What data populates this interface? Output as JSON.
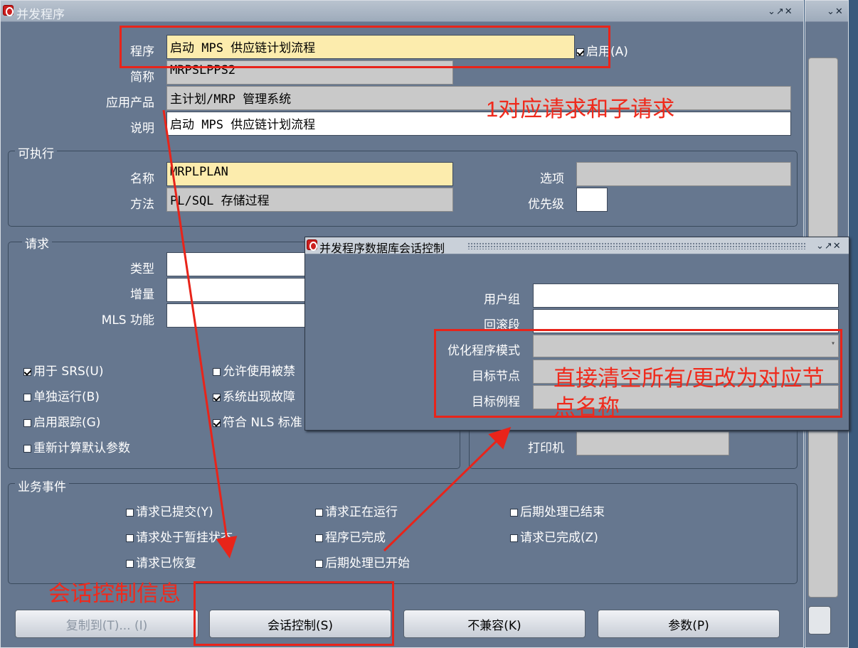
{
  "main_window": {
    "title": "并发程序",
    "controls": "⌄↗✕"
  },
  "form": {
    "program_label": "程序",
    "program_value": "启动 MPS 供应链计划流程",
    "enabled_label": "启用(A)",
    "shortname_label": "简称",
    "shortname_value": "MRPSLPPS2",
    "application_label": "应用产品",
    "application_value": "主计划/MRP 管理系统",
    "description_label": "说明",
    "description_value": "启动 MPS 供应链计划流程"
  },
  "executable": {
    "group_title": "可执行",
    "name_label": "名称",
    "name_value": "MRPLPLAN",
    "method_label": "方法",
    "method_value": "PL/SQL 存储过程",
    "options_label": "选项",
    "priority_label": "优先级"
  },
  "request": {
    "group_title": "请求",
    "type_label": "类型",
    "increment_label": "增量",
    "mls_label": "MLS 功能",
    "checkboxes": [
      {
        "label": "用于 SRS(U)",
        "checked": true
      },
      {
        "label": "允许使用被禁",
        "checked": false
      },
      {
        "label": "单独运行(B)",
        "checked": false
      },
      {
        "label": "系统出现故障",
        "checked": true
      },
      {
        "label": "启用跟踪(G)",
        "checked": false
      },
      {
        "label": "符合 NLS 标准",
        "checked": true
      },
      {
        "label": "重新计算默认参数",
        "checked": false
      }
    ],
    "printer_label": "打印机"
  },
  "business_events": {
    "group_title": "业务事件",
    "items": [
      {
        "label": "请求已提交(Y)",
        "checked": false
      },
      {
        "label": "请求正在运行",
        "checked": false
      },
      {
        "label": "后期处理已结束",
        "checked": false
      },
      {
        "label": "请求处于暂挂状态",
        "checked": false
      },
      {
        "label": "程序已完成",
        "checked": false
      },
      {
        "label": "请求已完成(Z)",
        "checked": false
      },
      {
        "label": "请求已恢复",
        "checked": false
      },
      {
        "label": "后期处理已开始",
        "checked": false
      }
    ]
  },
  "buttons": {
    "copy": "复制到(T)... (I)",
    "session_control": "会话控制(S)",
    "incompatible": "不兼容(K)",
    "parameters": "参数(P)"
  },
  "dialog": {
    "title": "并发程序数据库会话控制",
    "controls": "⌄↗✕",
    "user_group_label": "用户组",
    "rollback_label": "回滚段",
    "optimizer_label": "优化程序模式",
    "target_node_label": "目标节点",
    "target_instance_label": "目标例程"
  },
  "annotations": {
    "a1": "1对应请求和子请求",
    "a2_line1": "直接清空所有/更改为对应节",
    "a2_line2": "点名称",
    "a3": "会话控制信息"
  },
  "colors": {
    "annotation": "#e8241a",
    "required_field": "#fcecad",
    "window_bg": "#66778f"
  }
}
